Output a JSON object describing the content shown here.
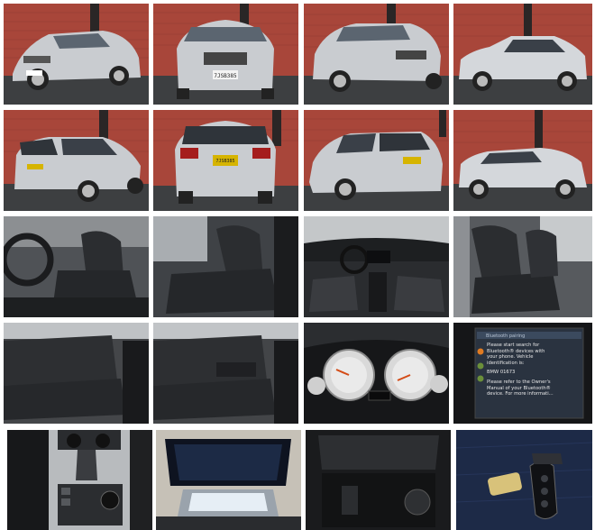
{
  "gallery": {
    "images": [
      {
        "view": "front-left exterior"
      },
      {
        "view": "front exterior"
      },
      {
        "view": "front-right exterior"
      },
      {
        "view": "right side exterior"
      },
      {
        "view": "rear-left exterior"
      },
      {
        "view": "rear exterior"
      },
      {
        "view": "rear-right exterior"
      },
      {
        "view": "left side exterior"
      },
      {
        "view": "driver seat"
      },
      {
        "view": "passenger seat"
      },
      {
        "view": "dashboard"
      },
      {
        "view": "front seats"
      },
      {
        "view": "rear seats left"
      },
      {
        "view": "rear seats armrest"
      },
      {
        "view": "instrument cluster"
      },
      {
        "view": "infotainment screen"
      },
      {
        "view": "center console shifter"
      },
      {
        "view": "panoramic sunroof"
      },
      {
        "view": "storage compartment"
      },
      {
        "view": "key fob"
      }
    ]
  },
  "screen": {
    "title": "Bluetooth pairing",
    "lines": [
      "Please start search for",
      "Bluetooth® devices with",
      "your phone. Vehicle",
      "identification is:",
      "BMW 01673",
      "Please refer to the Owner's",
      "Manual of your Bluetooth®",
      "device. For more informati..."
    ]
  },
  "plates": {
    "front": "7JSB385",
    "rear": "7JSB385"
  },
  "colors": {
    "brick": "#a8463a",
    "asphalt": "#3d3f41",
    "car_silver": "#c9ccd0",
    "leather": "#2b2d30"
  }
}
